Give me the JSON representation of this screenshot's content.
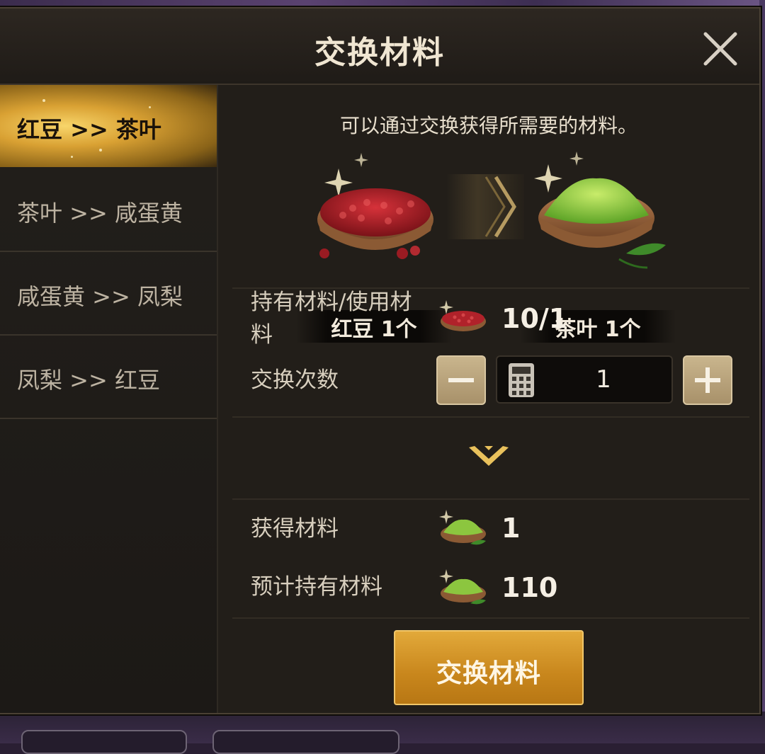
{
  "dialog": {
    "title": "交换材料"
  },
  "sidebar": {
    "items": [
      {
        "label": "红豆 >> 茶叶",
        "active": true
      },
      {
        "label": "茶叶 >> 咸蛋黄",
        "active": false
      },
      {
        "label": "咸蛋黄 >> 凤梨",
        "active": false
      },
      {
        "label": "凤梨 >> 红豆",
        "active": false
      }
    ]
  },
  "exchange": {
    "description": "可以通过交换获得所需要的材料。",
    "from_item": {
      "label": "红豆 1个",
      "icon": "red-bean-bowl-icon"
    },
    "to_item": {
      "label": "茶叶 1个",
      "icon": "tea-powder-bowl-icon"
    },
    "owned_used_label": "持有材料/使用材料",
    "owned_used_value": "10/1",
    "count_label": "交换次数",
    "count_value": "1",
    "obtain_label": "获得材料",
    "obtain_value": "1",
    "expected_label": "预计持有材料",
    "expected_value": "110",
    "submit_label": "交换材料"
  },
  "colors": {
    "accent_gold": "#d9a133",
    "button_orange": "#c8861c",
    "panel_bg": "#221e19",
    "text_main": "#e8dfcd"
  }
}
